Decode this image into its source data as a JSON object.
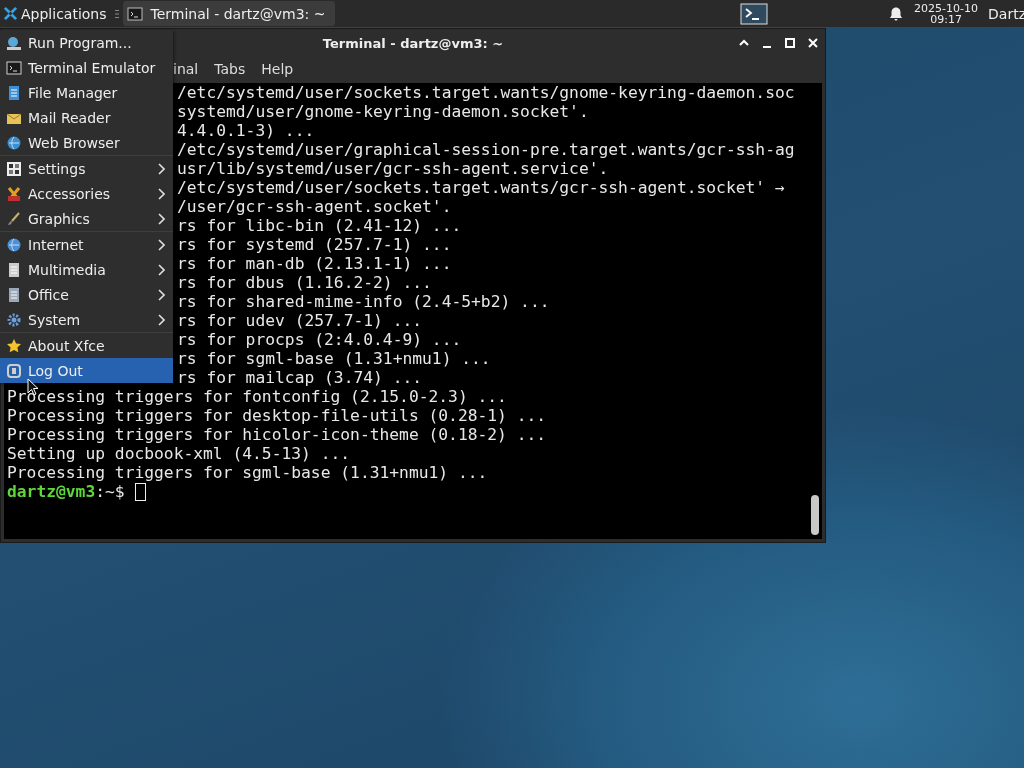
{
  "top_panel": {
    "applications_label": "Applications",
    "tasks": [
      {
        "title": "Terminal - dartz@vm3: ~",
        "selected": true
      }
    ],
    "clock": {
      "date": "2025-10-10",
      "time": "09:17"
    },
    "user": "Dartz"
  },
  "window": {
    "title": "Terminal - dartz@vm3: ~",
    "menubar": [
      "inal",
      "Tabs",
      "Help"
    ],
    "lines_behind_menu": [
      "/etc/systemd/user/sockets.target.wants/gnome-keyring-daemon.soc",
      "systemd/user/gnome-keyring-daemon.socket'.",
      "4.4.0.1-3) ...",
      "/etc/systemd/user/graphical-session-pre.target.wants/gcr-ssh-ag",
      "usr/lib/systemd/user/gcr-ssh-agent.service'.",
      "/etc/systemd/user/sockets.target.wants/gcr-ssh-agent.socket' →",
      "/user/gcr-ssh-agent.socket'.",
      "rs for libc-bin (2.41-12) ...",
      "rs for systemd (257.7-1) ...",
      "rs for man-db (2.13.1-1) ...",
      "rs for dbus (1.16.2-2) ...",
      "rs for shared-mime-info (2.4-5+b2) ...",
      "rs for udev (257.7-1) ...",
      "rs for procps (2:4.0.4-9) ...",
      "rs for sgml-base (1.31+nmu1) ...",
      "rs for mailcap (3.74) ..."
    ],
    "lines": [
      "Processing triggers for fontconfig (2.15.0-2.3) ...",
      "Processing triggers for desktop-file-utils (0.28-1) ...",
      "Processing triggers for hicolor-icon-theme (0.18-2) ...",
      "Setting up docbook-xml (4.5-13) ...",
      "Processing triggers for sgml-base (1.31+nmu1) ..."
    ],
    "prompt": {
      "user_host": "dartz@vm3",
      "path": ":~$"
    }
  },
  "app_menu": {
    "items": [
      {
        "kind": "item",
        "label": "Run Program...",
        "submenu": false,
        "selected": false
      },
      {
        "kind": "item",
        "label": "Terminal Emulator",
        "submenu": false,
        "selected": false
      },
      {
        "kind": "item",
        "label": "File Manager",
        "submenu": false,
        "selected": false
      },
      {
        "kind": "item",
        "label": "Mail Reader",
        "submenu": false,
        "selected": false
      },
      {
        "kind": "item",
        "label": "Web Browser",
        "submenu": false,
        "selected": false
      },
      {
        "kind": "separator"
      },
      {
        "kind": "item",
        "label": "Settings",
        "submenu": true,
        "selected": false
      },
      {
        "kind": "item",
        "label": "Accessories",
        "submenu": true,
        "selected": false
      },
      {
        "kind": "item",
        "label": "Graphics",
        "submenu": true,
        "selected": false
      },
      {
        "kind": "separator"
      },
      {
        "kind": "item",
        "label": "Internet",
        "submenu": true,
        "selected": false
      },
      {
        "kind": "item",
        "label": "Multimedia",
        "submenu": true,
        "selected": false
      },
      {
        "kind": "item",
        "label": "Office",
        "submenu": true,
        "selected": false
      },
      {
        "kind": "item",
        "label": "System",
        "submenu": true,
        "selected": false
      },
      {
        "kind": "separator"
      },
      {
        "kind": "item",
        "label": "About Xfce",
        "submenu": false,
        "selected": false
      },
      {
        "kind": "item",
        "label": "Log Out",
        "submenu": false,
        "selected": true
      }
    ]
  }
}
